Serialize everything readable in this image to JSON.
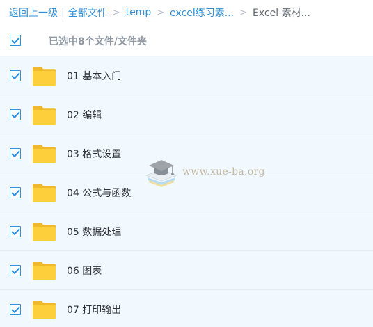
{
  "breadcrumb": {
    "back_label": "返回上一级",
    "all_files_label": "全部文件",
    "path": [
      "temp",
      "excel练习素...",
      "Excel 素材..."
    ]
  },
  "selection": {
    "summary": "已选中8个文件/文件夹",
    "checked": true
  },
  "files": [
    {
      "name": "01 基本入门",
      "type": "folder",
      "checked": true
    },
    {
      "name": "02 编辑",
      "type": "folder",
      "checked": true
    },
    {
      "name": "03 格式设置",
      "type": "folder",
      "checked": true
    },
    {
      "name": "04 公式与函数",
      "type": "folder",
      "checked": true
    },
    {
      "name": "05 数据处理",
      "type": "folder",
      "checked": true
    },
    {
      "name": "06 图表",
      "type": "folder",
      "checked": true
    },
    {
      "name": "07 打印输出",
      "type": "folder",
      "checked": true
    }
  ],
  "watermark": {
    "text": "www.xue-ba.org",
    "icon": "graduation-cap-icon"
  },
  "colors": {
    "accent": "#2b93df",
    "link": "#2f8fd6",
    "row_background": "#f1f8fe",
    "folder": "#fdd03b"
  }
}
